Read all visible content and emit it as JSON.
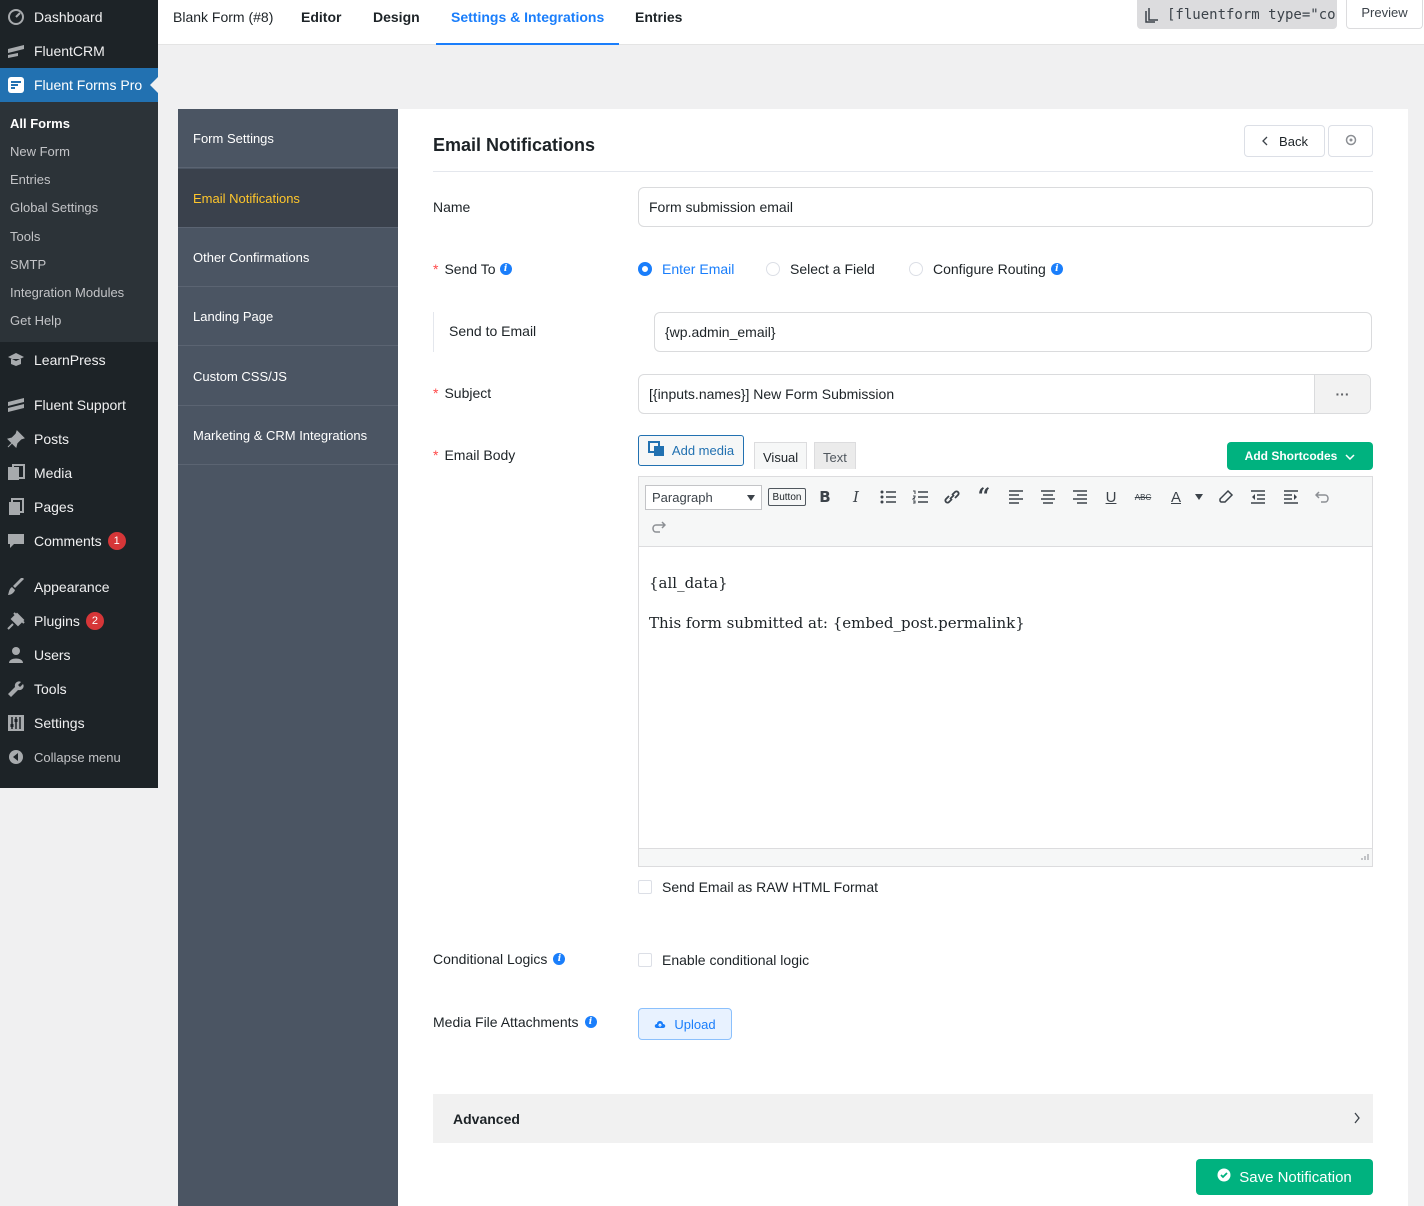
{
  "wp_menu": {
    "items": [
      {
        "label": "Dashboard",
        "icon": "dashboard-icon"
      },
      {
        "label": "FluentCRM",
        "icon": "fluentcrm-icon"
      },
      {
        "label": "Fluent Forms Pro",
        "icon": "fluent-forms-icon"
      },
      {
        "label": "LearnPress",
        "icon": "learnpress-icon"
      },
      {
        "label": "Fluent Support",
        "icon": "fluent-support-icon"
      },
      {
        "label": "Posts",
        "icon": "pin-icon"
      },
      {
        "label": "Media",
        "icon": "media-icon"
      },
      {
        "label": "Pages",
        "icon": "pages-icon"
      },
      {
        "label": "Comments",
        "icon": "comment-icon",
        "badge": "1"
      },
      {
        "label": "Appearance",
        "icon": "brush-icon"
      },
      {
        "label": "Plugins",
        "icon": "plugin-icon",
        "badge": "2"
      },
      {
        "label": "Users",
        "icon": "user-icon"
      },
      {
        "label": "Tools",
        "icon": "wrench-icon"
      },
      {
        "label": "Settings",
        "icon": "sliders-icon"
      }
    ],
    "submenu": [
      "All Forms",
      "New Form",
      "Entries",
      "Global Settings",
      "Tools",
      "SMTP",
      "Integration Modules",
      "Get Help"
    ],
    "collapse": "Collapse menu"
  },
  "topbar": {
    "form_name": "Blank Form (#8)",
    "tabs": [
      "Editor",
      "Design",
      "Settings & Integrations",
      "Entries"
    ],
    "shortcode": "[fluentform type=\"conver",
    "preview": "Preview"
  },
  "settings_nav": [
    "Form Settings",
    "Email Notifications",
    "Other Confirmations",
    "Landing Page",
    "Custom CSS/JS",
    "Marketing & CRM Integrations"
  ],
  "panel": {
    "title": "Email Notifications",
    "back": "Back",
    "name_label": "Name",
    "name_value": "Form submission email",
    "send_to_label": "Send To",
    "send_to_options": [
      "Enter Email",
      "Select a Field",
      "Configure Routing"
    ],
    "send_to_email_label": "Send to Email",
    "send_to_email_value": "{wp.admin_email}",
    "subject_label": "Subject",
    "subject_value": "[{inputs.names}] New Form Submission",
    "subject_more": "···",
    "body_label": "Email Body",
    "add_media": "Add media",
    "tab_visual": "Visual",
    "tab_text": "Text",
    "add_shortcodes": "Add Shortcodes",
    "format": "Paragraph",
    "button_chip": "Button",
    "body_line1": "{all_data}",
    "body_line2": "This form submitted at: {embed_post.permalink}",
    "raw_html": "Send Email as RAW HTML Format",
    "conditional_label": "Conditional Logics",
    "conditional_check": "Enable conditional logic",
    "attachments_label": "Media File Attachments",
    "upload": "Upload",
    "advanced": "Advanced",
    "save": "Save Notification"
  },
  "colors": {
    "accent": "#1a7efb",
    "green": "#00b27f",
    "wp_dark": "#1d2327",
    "wp_blue": "#2271b1",
    "side": "#4b5563",
    "active_yellow": "#fec62c"
  }
}
